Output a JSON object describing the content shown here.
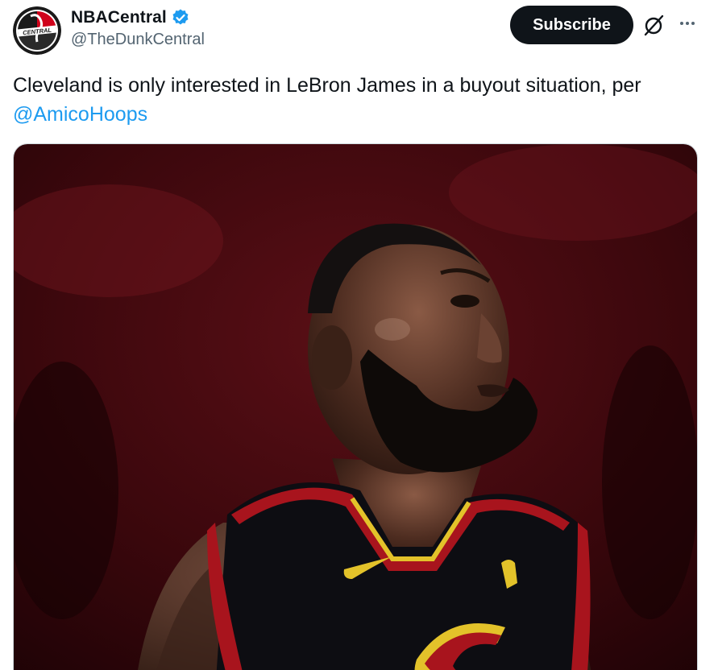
{
  "author": {
    "display_name": "NBACentral",
    "handle": "@TheDunkCentral",
    "verified": true,
    "avatar_text": "CENTRAL",
    "avatar_icon": "nbacentral-logo"
  },
  "actions": {
    "subscribe_label": "Subscribe",
    "grok_icon": "grok-icon",
    "more_icon": "more-options-icon"
  },
  "tweet": {
    "text": "Cleveland is only interested in LeBron James in a buyout situation, per",
    "mention": "@AmicoHoops"
  },
  "media": {
    "type": "photo",
    "alt": "photo"
  },
  "colors": {
    "link": "#1d9bf0",
    "verified": "#1d9bf0",
    "button_bg": "#0f1419",
    "secondary_text": "#536471"
  }
}
